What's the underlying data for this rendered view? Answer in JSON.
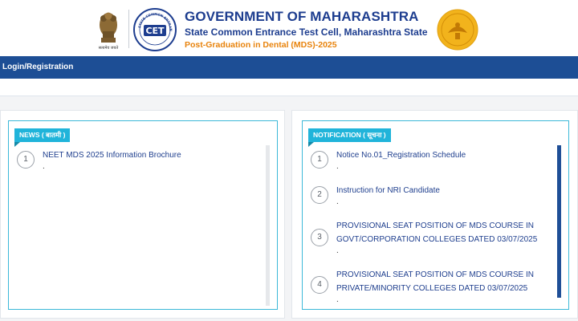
{
  "header": {
    "emblem_caption": "सत्यमेव जयते",
    "cet_logo_text": "CET",
    "cet_ring_text": "STATE COMMON ENTRANCE TEST CELL",
    "title": "GOVERNMENT OF MAHARASHTRA",
    "subtitle": "State Common Entrance Test Cell, Maharashtra State",
    "course": "Post-Graduation in Dental (MDS)-2025"
  },
  "nav": {
    "login_label": "Login/Registration"
  },
  "news": {
    "label": "NEWS ( बातमी )",
    "items": [
      {
        "num": "1",
        "text": "NEET MDS 2025 Information Brochure",
        "suffix": "."
      }
    ]
  },
  "notification": {
    "label": "NOTIFICATION ( सूचना )",
    "items": [
      {
        "num": "1",
        "text": "Notice No.01_Registration Schedule",
        "suffix": "."
      },
      {
        "num": "2",
        "text": "Instruction for NRI Candidate",
        "suffix": "."
      },
      {
        "num": "3",
        "text": "PROVISIONAL SEAT POSITION OF MDS COURSE IN GOVT/CORPORATION COLLEGES DATED 03/07/2025",
        "suffix": "."
      },
      {
        "num": "4",
        "text": "PROVISIONAL SEAT POSITION OF MDS COURSE IN PRIVATE/MINORITY COLLEGES DATED 03/07/2025",
        "suffix": "."
      }
    ]
  },
  "colors": {
    "brand_blue": "#1d3d8f",
    "nav_blue": "#1d4e95",
    "accent_orange": "#e8830c",
    "tab_cyan": "#20b4da"
  }
}
